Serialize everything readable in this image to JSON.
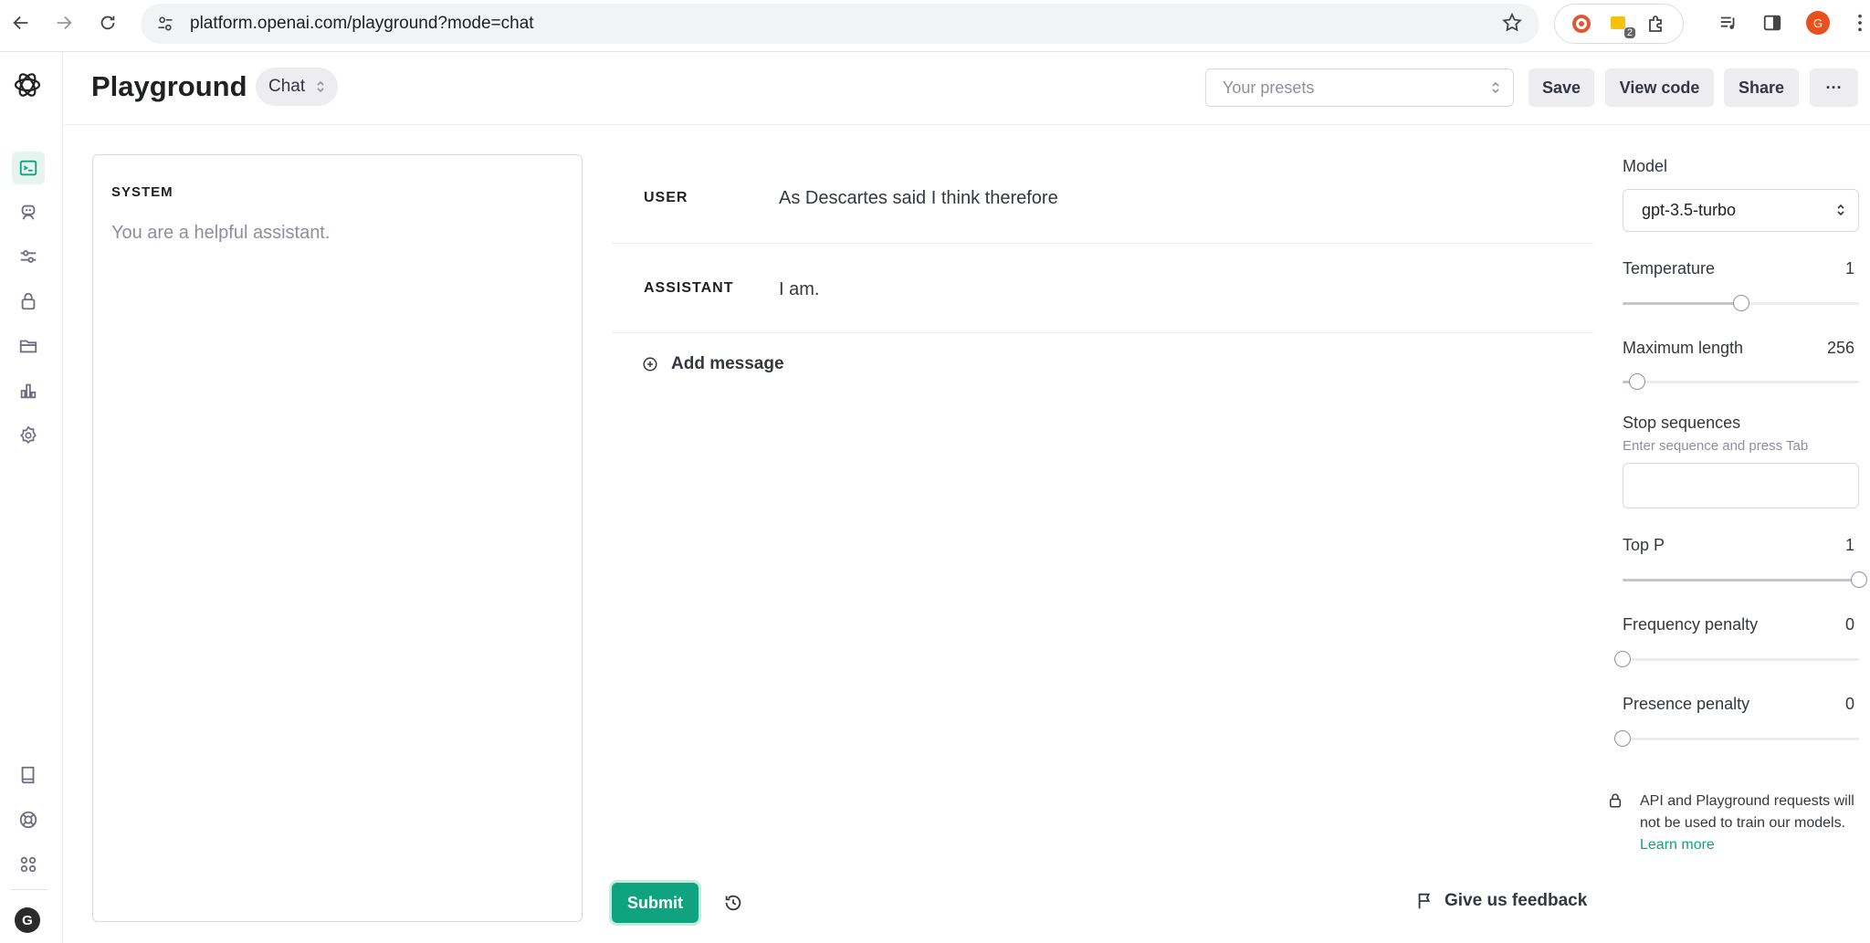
{
  "browser": {
    "url": "platform.openai.com/playground?mode=chat",
    "extension_badge": "2",
    "profile_initial": "G"
  },
  "sidebar": {
    "profile_initial": "G",
    "items": [
      {
        "icon": "terminal-icon",
        "active": true
      },
      {
        "icon": "assistant-bot-icon"
      },
      {
        "icon": "tune-sliders-icon"
      },
      {
        "icon": "lock-icon"
      },
      {
        "icon": "folder-icon"
      },
      {
        "icon": "bar-chart-icon"
      },
      {
        "icon": "gear-icon"
      }
    ],
    "bottom_items": [
      {
        "icon": "book-icon"
      },
      {
        "icon": "help-lifebuoy-icon"
      },
      {
        "icon": "apps-grid-icon"
      }
    ]
  },
  "header": {
    "title": "Playground",
    "mode": "Chat",
    "presets_placeholder": "Your presets",
    "save_label": "Save",
    "view_code_label": "View code",
    "share_label": "Share",
    "more_label": "···"
  },
  "system": {
    "label": "SYSTEM",
    "text": "You are a helpful assistant."
  },
  "messages": [
    {
      "role": "USER",
      "content": "As Descartes said I think therefore"
    },
    {
      "role": "ASSISTANT",
      "content": "I am."
    }
  ],
  "add_message_label": "Add message",
  "submit_label": "Submit",
  "feedback_label": "Give us feedback",
  "settings": {
    "model_label": "Model",
    "model_value": "gpt-3.5-turbo",
    "temperature": {
      "label": "Temperature",
      "value": "1",
      "fraction": 0.5
    },
    "max_length": {
      "label": "Maximum length",
      "value": "256",
      "fraction": 0.06
    },
    "stop_sequences": {
      "label": "Stop sequences",
      "hint": "Enter sequence and press Tab"
    },
    "top_p": {
      "label": "Top P",
      "value": "1",
      "fraction": 1.0
    },
    "frequency_penalty": {
      "label": "Frequency penalty",
      "value": "0",
      "fraction": 0.0
    },
    "presence_penalty": {
      "label": "Presence penalty",
      "value": "0",
      "fraction": 0.0
    }
  },
  "notice": {
    "text": "API and Playground requests will not be used to train our models.",
    "link": "Learn more"
  },
  "colors": {
    "accent": "#10a37f",
    "text": "#202123",
    "muted": "#8e8ea0"
  }
}
